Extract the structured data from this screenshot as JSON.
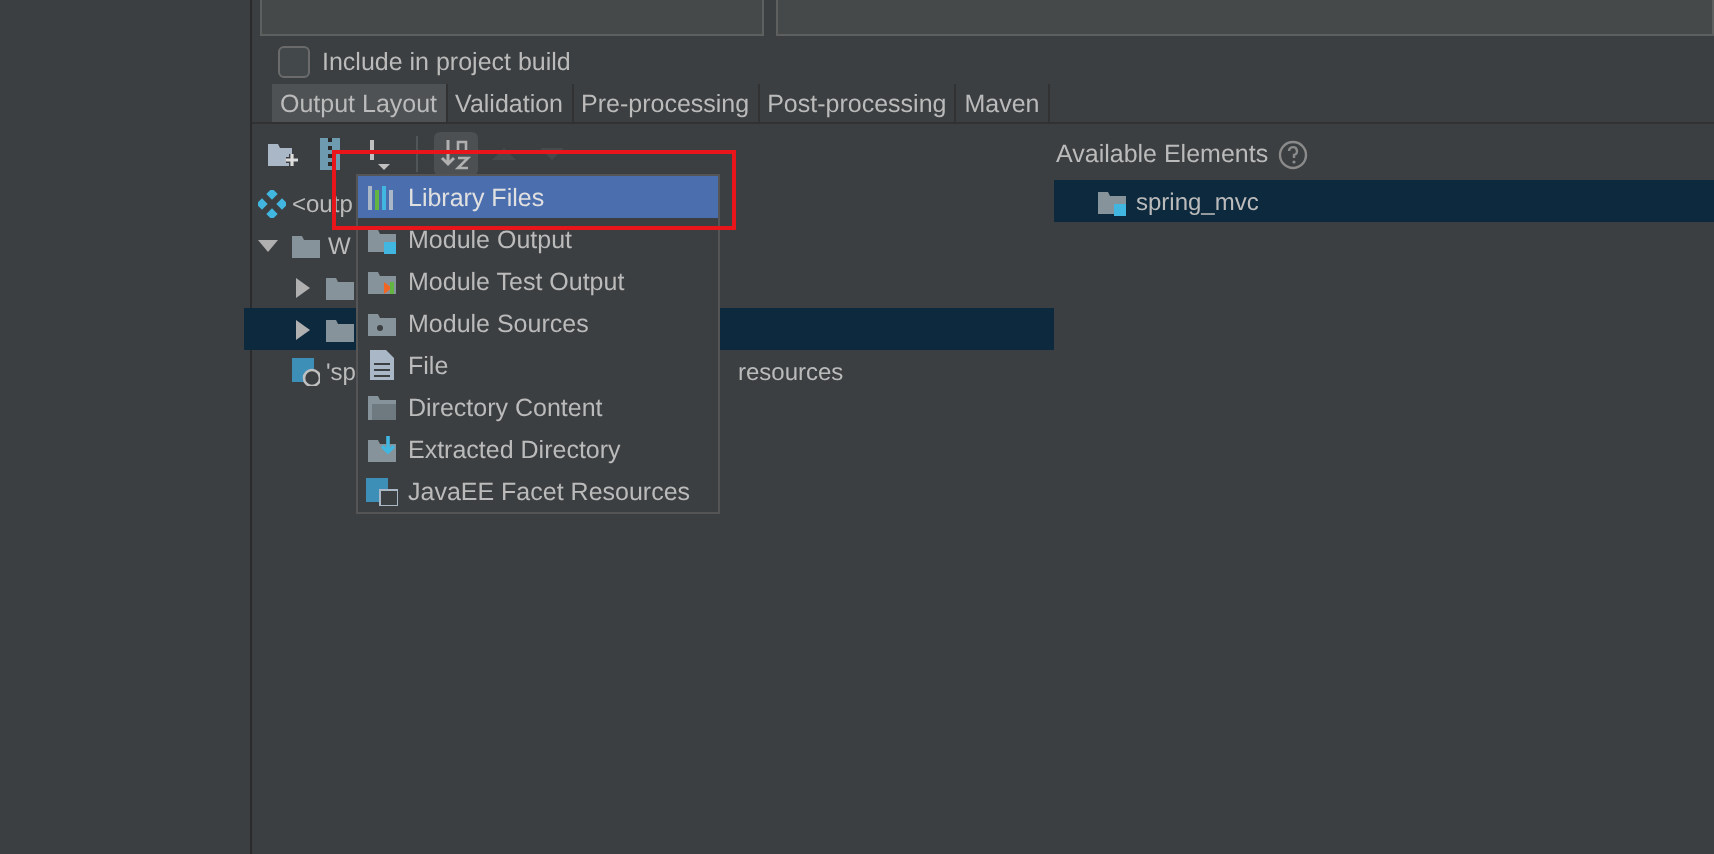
{
  "include_checkbox": {
    "label": "Include in project build",
    "checked": false
  },
  "tabs": [
    {
      "label": "Output Layout",
      "selected": true
    },
    {
      "label": "Validation",
      "selected": false
    },
    {
      "label": "Pre-processing",
      "selected": false
    },
    {
      "label": "Post-processing",
      "selected": false
    },
    {
      "label": "Maven",
      "selected": false
    }
  ],
  "toolbar": [
    {
      "kind": "add-folder",
      "disabled": false,
      "pressed": false
    },
    {
      "kind": "archive",
      "disabled": false,
      "pressed": false
    },
    {
      "kind": "add-dropdown",
      "disabled": false,
      "pressed": false
    },
    {
      "kind": "sort",
      "disabled": false,
      "pressed": true
    },
    {
      "kind": "up",
      "disabled": true,
      "pressed": false
    },
    {
      "kind": "down",
      "disabled": true,
      "pressed": false
    }
  ],
  "tree": [
    {
      "kind": "root",
      "label": "<outp",
      "selected": false
    },
    {
      "kind": "folder",
      "label": "W",
      "expanded": true,
      "selected": false,
      "children": [
        {
          "kind": "folder",
          "expanded": false,
          "selected": false
        },
        {
          "kind": "folder",
          "expanded": false,
          "selected": true
        },
        {
          "kind": "web",
          "label": "'sp",
          "label_after": "resources",
          "selected": false
        }
      ]
    }
  ],
  "available": {
    "title": "Available Elements",
    "items": [
      {
        "label": "spring_mvc",
        "selected": true
      }
    ]
  },
  "menu": [
    {
      "kind": "library",
      "label": "Library Files",
      "selected": true
    },
    {
      "kind": "module",
      "label": "Module Output",
      "selected": false
    },
    {
      "kind": "test",
      "label": "Module Test Output",
      "selected": false
    },
    {
      "kind": "sources",
      "label": "Module Sources",
      "selected": false
    },
    {
      "kind": "file",
      "label": "File",
      "selected": false
    },
    {
      "kind": "dir",
      "label": "Directory Content",
      "selected": false
    },
    {
      "kind": "extract",
      "label": "Extracted Directory",
      "selected": false
    },
    {
      "kind": "javaee",
      "label": "JavaEE Facet Resources",
      "selected": false
    }
  ]
}
